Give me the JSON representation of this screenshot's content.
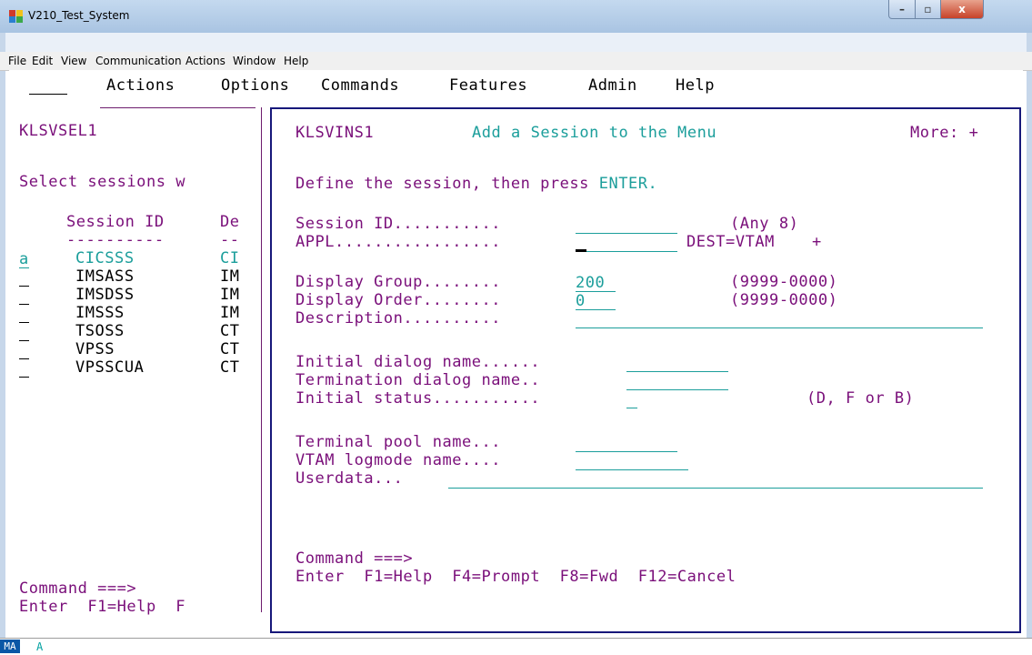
{
  "window": {
    "title": "V210_Test_System",
    "min_glyph": "–",
    "max_glyph": "▫",
    "close_glyph": "x"
  },
  "menubar": {
    "items": [
      {
        "label": "File"
      },
      {
        "label": "Edit"
      },
      {
        "label": "View"
      },
      {
        "label": "Communication"
      },
      {
        "label": "Actions"
      },
      {
        "label": "Window"
      },
      {
        "label": "Help"
      }
    ]
  },
  "screen": {
    "action_bar": {
      "field_value": "",
      "items": [
        "Actions",
        "Options",
        "Commands",
        "Features",
        "Admin",
        "Help"
      ]
    },
    "left_panel": {
      "panel_id": "KLSVSEL1",
      "instruction": "Select sessions w",
      "col_session": "Session ID",
      "col_desc": "De",
      "col_session_dash": "----------",
      "col_desc_dash": "--",
      "rows": [
        {
          "sel": "a",
          "id": "CICSSS",
          "desc": "CI"
        },
        {
          "sel": "",
          "id": "IMSASS",
          "desc": "IM"
        },
        {
          "sel": "",
          "id": "IMSDSS",
          "desc": "IM"
        },
        {
          "sel": "",
          "id": "IMSSS",
          "desc": "IM"
        },
        {
          "sel": "",
          "id": "TSOSS",
          "desc": "CT"
        },
        {
          "sel": "",
          "id": "VPSS",
          "desc": "CT"
        },
        {
          "sel": "",
          "id": "VPSSCUA",
          "desc": "CT"
        }
      ],
      "command_label": "Command ===>",
      "keys": "Enter  F1=Help  F"
    },
    "popup": {
      "panel_id": "KLSVINS1",
      "title": "Add a Session to the Menu",
      "more": "More: +",
      "instruction_text": "Define the session, then press ",
      "instruction_key": "ENTER.",
      "fields": {
        "session_id_label": "Session ID...........",
        "session_id_value": "",
        "session_id_hint": "(Any 8)",
        "appl_label": "APPL.................",
        "appl_value": "",
        "appl_dest": "DEST=VTAM",
        "appl_plus": "+",
        "display_group_label": "Display Group........",
        "display_group_value": "200",
        "display_group_hint": "(9999-0000)",
        "display_order_label": "Display Order........",
        "display_order_value": "0",
        "display_order_hint": "(9999-0000)",
        "description_label": "Description..........",
        "description_value": "",
        "initial_dialog_label": "Initial dialog name......",
        "initial_dialog_value": "",
        "termination_dialog_label": "Termination dialog name..",
        "termination_dialog_value": "",
        "initial_status_label": "Initial status...........",
        "initial_status_value": "",
        "initial_status_hint": "(D, F or B)",
        "terminal_pool_label": "Terminal pool name...",
        "terminal_pool_value": "",
        "logmode_label": "VTAM logmode name....",
        "logmode_value": "",
        "userdata_label": "Userdata...",
        "userdata_value": ""
      },
      "command_label": "Command ===>",
      "keys": "Enter  F1=Help  F4=Prompt  F8=Fwd  F12=Cancel"
    }
  },
  "status_bar": {
    "oia_left": "MA",
    "oia_indicator": "A"
  },
  "colors": {
    "label_purple": "#7a0f7a",
    "field_teal": "#1b9e9b",
    "popup_border": "#17187a"
  }
}
